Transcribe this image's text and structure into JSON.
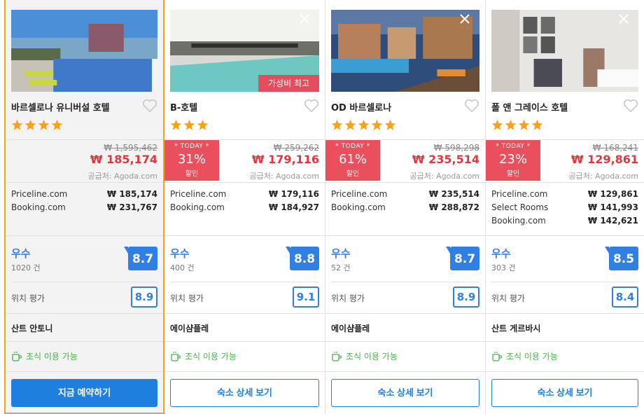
{
  "hotels": [
    {
      "name": "바르셀로나 유니버설 호텔",
      "stars": 4,
      "old_price": "₩ 1,595,462",
      "price": "₩ 185,174",
      "supplier": "공급처: Agoda.com",
      "deal": null,
      "offers": [
        {
          "site": "Priceline.com",
          "amount": "₩ 185,174"
        },
        {
          "site": "Booking.com",
          "amount": "₩ 231,767"
        }
      ],
      "rating_word": "우수",
      "review_count": "1020 건",
      "score": "8.7",
      "location_label": "위치 평가",
      "location_score": "8.9",
      "area": "산트 안토니",
      "breakfast": "조식 이용 가능",
      "button": "지금 예약하기"
    },
    {
      "name": "B-호텔",
      "stars": 3,
      "badge": "가성비 최고",
      "old_price": "₩ 259,262",
      "price": "₩ 179,116",
      "supplier": "공급처: Agoda.com",
      "deal": {
        "today": "* TODAY *",
        "percent": "31%",
        "label": "할인"
      },
      "offers": [
        {
          "site": "Priceline.com",
          "amount": "₩ 179,116"
        },
        {
          "site": "Booking.com",
          "amount": "₩ 184,927"
        }
      ],
      "rating_word": "우수",
      "review_count": "400 건",
      "score": "8.8",
      "location_label": "위치 평가",
      "location_score": "9.1",
      "area": "에이샴플레",
      "breakfast": "조식 이용 가능",
      "button": "숙소 상세 보기"
    },
    {
      "name": "OD 바르셀로나",
      "stars": 5,
      "old_price": "₩ 598,298",
      "price": "₩ 235,514",
      "supplier": "공급처: Agoda.com",
      "deal": {
        "today": "* TODAY *",
        "percent": "61%",
        "label": "할인"
      },
      "offers": [
        {
          "site": "Priceline.com",
          "amount": "₩ 235,514"
        },
        {
          "site": "Booking.com",
          "amount": "₩ 288,872"
        }
      ],
      "rating_word": "우수",
      "review_count": "52 건",
      "score": "8.7",
      "location_label": "위치 평가",
      "location_score": "8.9",
      "area": "에이샴플레",
      "breakfast": "조식 이용 가능",
      "button": "숙소 상세 보기"
    },
    {
      "name": "폴 앤 그레이스 호텔",
      "stars": 4,
      "old_price": "₩ 168,241",
      "price": "₩ 129,861",
      "supplier": "공급처: Agoda.com",
      "deal": {
        "today": "* TODAY *",
        "percent": "23%",
        "label": "할인"
      },
      "offers": [
        {
          "site": "Priceline.com",
          "amount": "₩ 129,861"
        },
        {
          "site": "Select Rooms",
          "amount": "₩ 141,993"
        },
        {
          "site": "Booking.com",
          "amount": "₩ 142,621"
        }
      ],
      "rating_word": "우수",
      "review_count": "303 건",
      "score": "8.5",
      "location_label": "위치 평가",
      "location_score": "8.4",
      "area": "산트 게르바시",
      "breakfast": "조식 이용 가능",
      "button": "숙소 상세 보기"
    }
  ],
  "colors": {
    "accent_blue": "#1f7fe0",
    "deal_red": "#e94f5d",
    "price_red": "#e2363d",
    "star_gold": "#f5a21f",
    "breakfast_green": "#4caf50",
    "selected_border": "#f5a21f"
  },
  "icons": {
    "star": "star-icon",
    "heart": "heart-icon",
    "close": "close-icon",
    "breakfast": "coffee-cup-icon"
  }
}
